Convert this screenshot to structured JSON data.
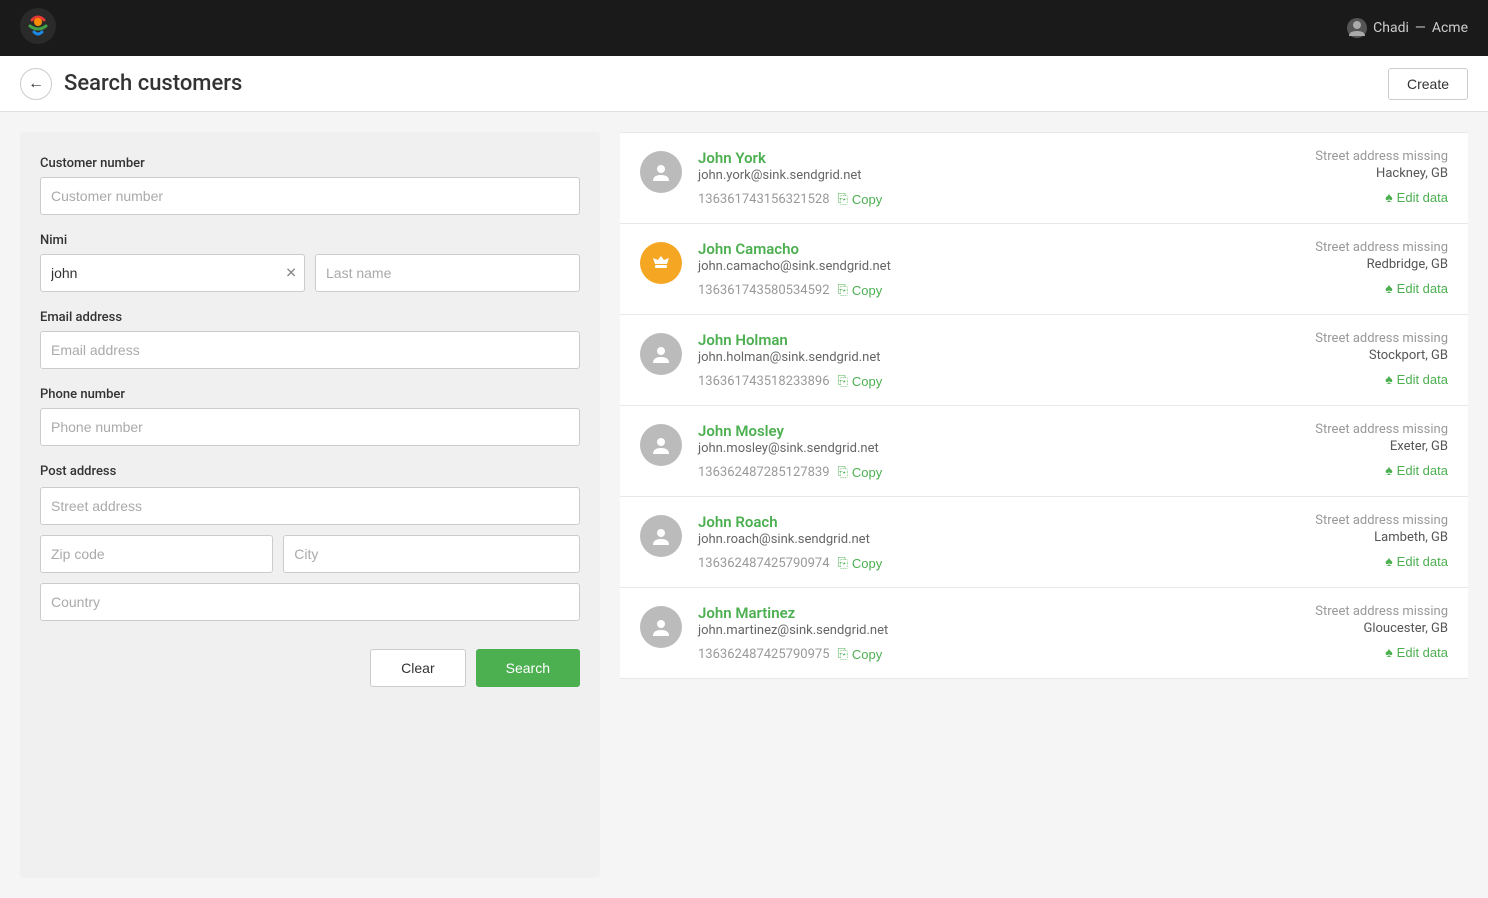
{
  "topnav": {
    "user_label": "Chadi",
    "separator": "—",
    "org_label": "Acme"
  },
  "header": {
    "title": "Search customers",
    "create_btn": "Create"
  },
  "form": {
    "customer_number_label": "Customer number",
    "customer_number_placeholder": "Customer number",
    "name_label": "Nimi",
    "first_name_value": "john",
    "last_name_placeholder": "Last name",
    "email_label": "Email address",
    "email_placeholder": "Email address",
    "phone_label": "Phone number",
    "phone_placeholder": "Phone number",
    "post_label": "Post address",
    "street_placeholder": "Street address",
    "zip_placeholder": "Zip code",
    "city_placeholder": "City",
    "country_placeholder": "Country",
    "clear_btn": "Clear",
    "search_btn": "Search"
  },
  "results": [
    {
      "name": "John York",
      "email": "john.york@sink.sendgrid.net",
      "id": "136361743156321528",
      "copy_label": "Copy",
      "street_status": "Street address missing",
      "location": "Hackney, GB",
      "edit_label": "Edit data",
      "is_vip": false
    },
    {
      "name": "John Camacho",
      "email": "john.camacho@sink.sendgrid.net",
      "id": "136361743580534592",
      "copy_label": "Copy",
      "street_status": "Street address missing",
      "location": "Redbridge, GB",
      "edit_label": "Edit data",
      "is_vip": true
    },
    {
      "name": "John Holman",
      "email": "john.holman@sink.sendgrid.net",
      "id": "136361743518233896",
      "copy_label": "Copy",
      "street_status": "Street address missing",
      "location": "Stockport, GB",
      "edit_label": "Edit data",
      "is_vip": false
    },
    {
      "name": "John Mosley",
      "email": "john.mosley@sink.sendgrid.net",
      "id": "136362487285127839",
      "copy_label": "Copy",
      "street_status": "Street address missing",
      "location": "Exeter, GB",
      "edit_label": "Edit data",
      "is_vip": false
    },
    {
      "name": "John Roach",
      "email": "john.roach@sink.sendgrid.net",
      "id": "136362487425790974",
      "copy_label": "Copy",
      "street_status": "Street address missing",
      "location": "Lambeth, GB",
      "edit_label": "Edit data",
      "is_vip": false
    },
    {
      "name": "John Martinez",
      "email": "john.martinez@sink.sendgrid.net",
      "id": "136362487425790975",
      "copy_label": "Copy",
      "street_status": "Street address missing",
      "location": "Gloucester, GB",
      "edit_label": "Edit data",
      "is_vip": false
    }
  ]
}
